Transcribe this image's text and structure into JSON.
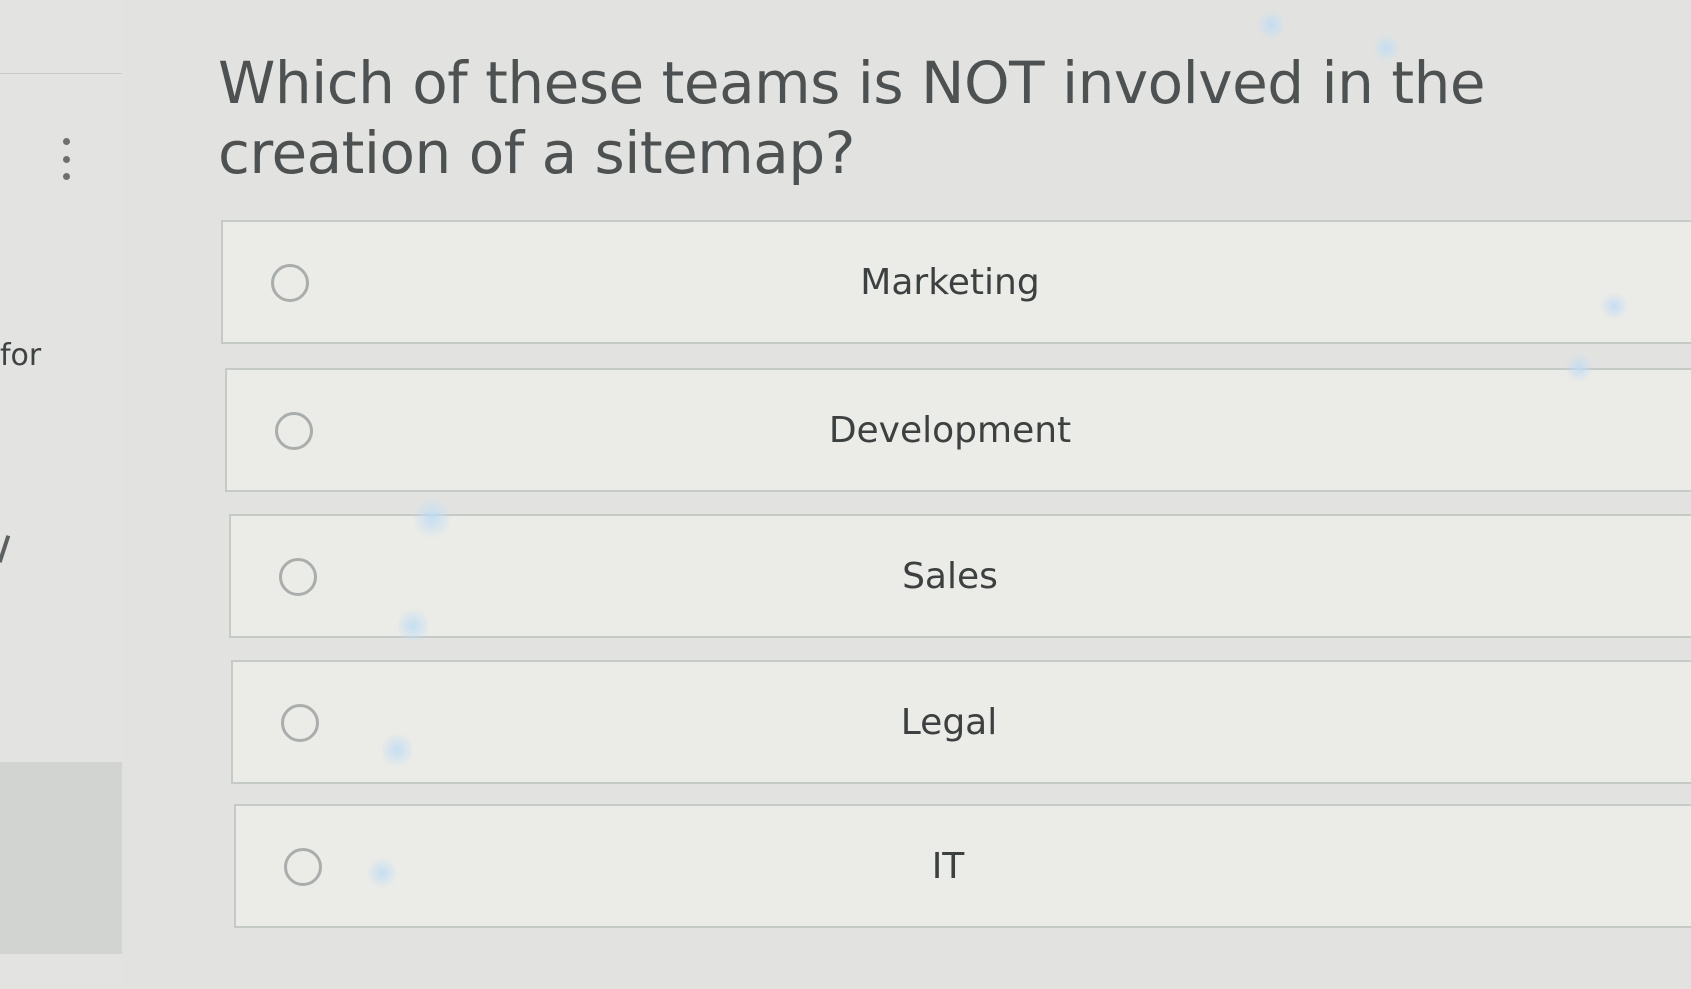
{
  "sidebar": {
    "menu_icon": "vertical-ellipsis-icon",
    "fragment_text": "for"
  },
  "question": {
    "text": "Which of these teams is NOT involved in the creation of a sitemap?"
  },
  "options": [
    {
      "label": "Marketing",
      "selected": false
    },
    {
      "label": "Development",
      "selected": false
    },
    {
      "label": "Sales",
      "selected": false
    },
    {
      "label": "Legal",
      "selected": false
    },
    {
      "label": "IT",
      "selected": false
    }
  ],
  "colors": {
    "page_background": "#e2e3e0",
    "option_background": "#ebebe7",
    "option_border": "#c6cac7",
    "text": "#3c4040",
    "radio_border": "#a9adab"
  }
}
